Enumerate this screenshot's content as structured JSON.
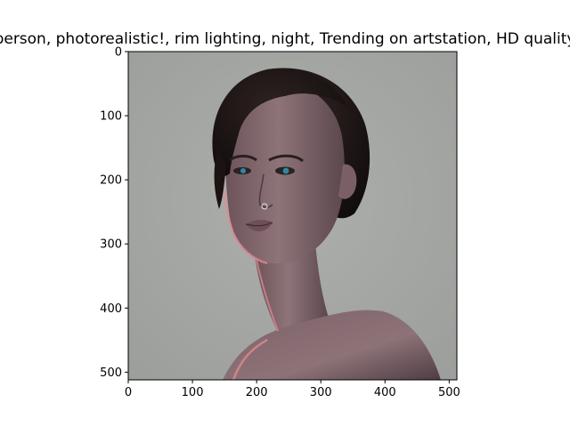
{
  "figure": {
    "title": "person,  photorealistic!, rim lighting, night, Trending on artstation, HD quality"
  },
  "image": {
    "description_shape": "portrait",
    "background_color": "#a5a7a4",
    "skin_color": "#8a6f73",
    "skin_shadow_color": "#5e4a50",
    "hair_color": "#1f1716",
    "rim_light_color": "#e58a92",
    "eye_color": "#2a8aa0"
  },
  "axes": {
    "x": {
      "ticks": [
        {
          "value": 0,
          "label": "0"
        },
        {
          "value": 100,
          "label": "100"
        },
        {
          "value": 200,
          "label": "200"
        },
        {
          "value": 300,
          "label": "300"
        },
        {
          "value": 400,
          "label": "400"
        },
        {
          "value": 500,
          "label": "500"
        }
      ],
      "range": [
        0,
        512
      ]
    },
    "y": {
      "ticks": [
        {
          "value": 0,
          "label": "0"
        },
        {
          "value": 100,
          "label": "100"
        },
        {
          "value": 200,
          "label": "200"
        },
        {
          "value": 300,
          "label": "300"
        },
        {
          "value": 400,
          "label": "400"
        },
        {
          "value": 500,
          "label": "500"
        }
      ],
      "range": [
        0,
        512
      ]
    }
  }
}
